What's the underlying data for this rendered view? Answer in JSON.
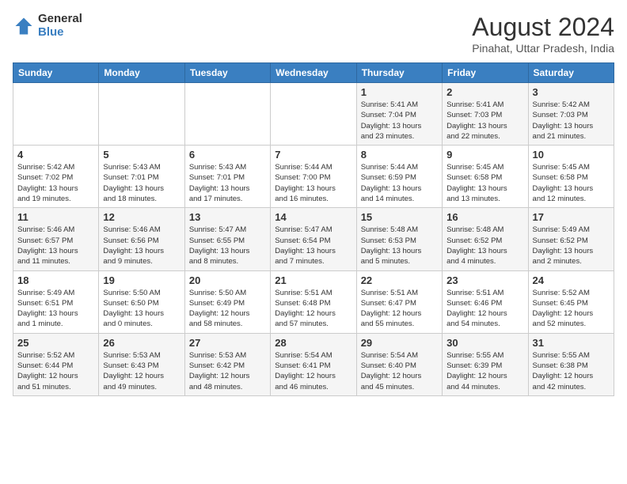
{
  "header": {
    "logo_general": "General",
    "logo_blue": "Blue",
    "month_year": "August 2024",
    "location": "Pinahat, Uttar Pradesh, India"
  },
  "days_of_week": [
    "Sunday",
    "Monday",
    "Tuesday",
    "Wednesday",
    "Thursday",
    "Friday",
    "Saturday"
  ],
  "weeks": [
    [
      {
        "day": "",
        "info": ""
      },
      {
        "day": "",
        "info": ""
      },
      {
        "day": "",
        "info": ""
      },
      {
        "day": "",
        "info": ""
      },
      {
        "day": "1",
        "info": "Sunrise: 5:41 AM\nSunset: 7:04 PM\nDaylight: 13 hours\nand 23 minutes."
      },
      {
        "day": "2",
        "info": "Sunrise: 5:41 AM\nSunset: 7:03 PM\nDaylight: 13 hours\nand 22 minutes."
      },
      {
        "day": "3",
        "info": "Sunrise: 5:42 AM\nSunset: 7:03 PM\nDaylight: 13 hours\nand 21 minutes."
      }
    ],
    [
      {
        "day": "4",
        "info": "Sunrise: 5:42 AM\nSunset: 7:02 PM\nDaylight: 13 hours\nand 19 minutes."
      },
      {
        "day": "5",
        "info": "Sunrise: 5:43 AM\nSunset: 7:01 PM\nDaylight: 13 hours\nand 18 minutes."
      },
      {
        "day": "6",
        "info": "Sunrise: 5:43 AM\nSunset: 7:01 PM\nDaylight: 13 hours\nand 17 minutes."
      },
      {
        "day": "7",
        "info": "Sunrise: 5:44 AM\nSunset: 7:00 PM\nDaylight: 13 hours\nand 16 minutes."
      },
      {
        "day": "8",
        "info": "Sunrise: 5:44 AM\nSunset: 6:59 PM\nDaylight: 13 hours\nand 14 minutes."
      },
      {
        "day": "9",
        "info": "Sunrise: 5:45 AM\nSunset: 6:58 PM\nDaylight: 13 hours\nand 13 minutes."
      },
      {
        "day": "10",
        "info": "Sunrise: 5:45 AM\nSunset: 6:58 PM\nDaylight: 13 hours\nand 12 minutes."
      }
    ],
    [
      {
        "day": "11",
        "info": "Sunrise: 5:46 AM\nSunset: 6:57 PM\nDaylight: 13 hours\nand 11 minutes."
      },
      {
        "day": "12",
        "info": "Sunrise: 5:46 AM\nSunset: 6:56 PM\nDaylight: 13 hours\nand 9 minutes."
      },
      {
        "day": "13",
        "info": "Sunrise: 5:47 AM\nSunset: 6:55 PM\nDaylight: 13 hours\nand 8 minutes."
      },
      {
        "day": "14",
        "info": "Sunrise: 5:47 AM\nSunset: 6:54 PM\nDaylight: 13 hours\nand 7 minutes."
      },
      {
        "day": "15",
        "info": "Sunrise: 5:48 AM\nSunset: 6:53 PM\nDaylight: 13 hours\nand 5 minutes."
      },
      {
        "day": "16",
        "info": "Sunrise: 5:48 AM\nSunset: 6:52 PM\nDaylight: 13 hours\nand 4 minutes."
      },
      {
        "day": "17",
        "info": "Sunrise: 5:49 AM\nSunset: 6:52 PM\nDaylight: 13 hours\nand 2 minutes."
      }
    ],
    [
      {
        "day": "18",
        "info": "Sunrise: 5:49 AM\nSunset: 6:51 PM\nDaylight: 13 hours\nand 1 minute."
      },
      {
        "day": "19",
        "info": "Sunrise: 5:50 AM\nSunset: 6:50 PM\nDaylight: 13 hours\nand 0 minutes."
      },
      {
        "day": "20",
        "info": "Sunrise: 5:50 AM\nSunset: 6:49 PM\nDaylight: 12 hours\nand 58 minutes."
      },
      {
        "day": "21",
        "info": "Sunrise: 5:51 AM\nSunset: 6:48 PM\nDaylight: 12 hours\nand 57 minutes."
      },
      {
        "day": "22",
        "info": "Sunrise: 5:51 AM\nSunset: 6:47 PM\nDaylight: 12 hours\nand 55 minutes."
      },
      {
        "day": "23",
        "info": "Sunrise: 5:51 AM\nSunset: 6:46 PM\nDaylight: 12 hours\nand 54 minutes."
      },
      {
        "day": "24",
        "info": "Sunrise: 5:52 AM\nSunset: 6:45 PM\nDaylight: 12 hours\nand 52 minutes."
      }
    ],
    [
      {
        "day": "25",
        "info": "Sunrise: 5:52 AM\nSunset: 6:44 PM\nDaylight: 12 hours\nand 51 minutes."
      },
      {
        "day": "26",
        "info": "Sunrise: 5:53 AM\nSunset: 6:43 PM\nDaylight: 12 hours\nand 49 minutes."
      },
      {
        "day": "27",
        "info": "Sunrise: 5:53 AM\nSunset: 6:42 PM\nDaylight: 12 hours\nand 48 minutes."
      },
      {
        "day": "28",
        "info": "Sunrise: 5:54 AM\nSunset: 6:41 PM\nDaylight: 12 hours\nand 46 minutes."
      },
      {
        "day": "29",
        "info": "Sunrise: 5:54 AM\nSunset: 6:40 PM\nDaylight: 12 hours\nand 45 minutes."
      },
      {
        "day": "30",
        "info": "Sunrise: 5:55 AM\nSunset: 6:39 PM\nDaylight: 12 hours\nand 44 minutes."
      },
      {
        "day": "31",
        "info": "Sunrise: 5:55 AM\nSunset: 6:38 PM\nDaylight: 12 hours\nand 42 minutes."
      }
    ]
  ]
}
